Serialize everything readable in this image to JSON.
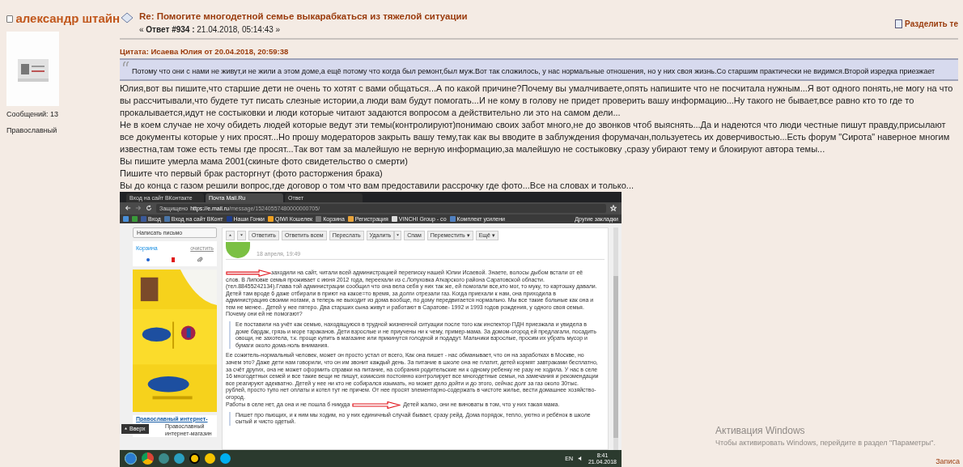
{
  "post": {
    "checked": false,
    "author": "александр штайн",
    "posts_count": "Сообщений: 13",
    "rank": "Православный",
    "title": "Re: Помогите многодетной семье выкарабкаться из тяжелой ситуации",
    "reply_prefix": "« ",
    "reply_label": "Ответ #934 :",
    "reply_date": " 21.04.2018, 05:14:43 »",
    "split_link": "Разделить те",
    "quote_header": "Цитата: Исаева Юлия от 20.04.2018, 20:59:38",
    "quote_text": "Потому что они с нами не живут,и не жили а этом доме,а ещё потому что когда был ремонт,был муж.Вот так сложилось, у нас нормальные отношения, но у них своя жизнь.Со старшим практически не видимся.Второй изредка приезжает",
    "body": [
      "Юлия,вот вы пишите,что старшие дети не очень то хотят с вами общаться...А по какой причине?Почему вы умалчиваете,опять напишите что не посчитала нужным...Я вот одного понять,не могу на что вы рассчитывали,что будете тут писать слезные истории,а люди вам будут помогать...И не кому в голову не придет проверить вашу информацию...Ну такого не бывает,все равно кто то где то прокалывается,идут не состыковки и люди которые читают задаются вопросом а действительно ли это на самом дели...",
      "Не в коем случае не хочу обидеть людей которые ведут эти темы(контролируют)понимаю своих забот много,не до звонков чтоб выяснять...Да и надеются что люди честные пишут правду,присылают все документы которые у них просят...Но прошу модераторов закрыть вашу тему,так как вы вводите в заблуждения форумачан,пользуетесь их доверчивостью...Есть форум \"Сирота\" наверное многим известна,там тоже есть темы где просят...Так вот там за малейшую не верную информацию,за малейшую не состыковку ,сразу убирают тему и блокируют автора темы...",
      "Вы пишите умерла мама 2001(скиньте фото свидетельство о смерти)",
      "Пишите что первый брак  расторгнут (фото расторжения брака)",
      "Вы до конца с газом решили вопрос,где договор о том что вам предоставили рассрочку где фото...Все на словах и только..."
    ],
    "footer_link": "Записа"
  },
  "attached_screenshot": {
    "tabs": [
      {
        "label": "Вход на сайт ВКонтакте",
        "selected": false
      },
      {
        "label": "Почта Mail.Ru",
        "selected": true
      },
      {
        "label": "Ответ",
        "selected": false
      }
    ],
    "secure_label": "Защищено",
    "url_host": "https://e.mail.ru",
    "url_path": "/message/15240557480000000705/",
    "bookmarks": [
      "Вход",
      "Вход на сайт ВКонт",
      "Наши Гонки",
      "QIWI Кошелек",
      "Корзина",
      "Регистрация",
      "VINCHI Group - со",
      "Комплект усилени"
    ],
    "other_bookmarks": "Другие закладки",
    "compose_button": "Написать письмо",
    "trash_folder": "Корзина",
    "clear_link": "очистить",
    "toolbar": [
      {
        "label": "Ответить",
        "dropdown": false
      },
      {
        "label": "Ответить всем",
        "dropdown": false
      },
      {
        "label": "Переслать",
        "dropdown": false
      },
      {
        "label": "Удалить",
        "dropdown": true
      },
      {
        "label": "Спам",
        "dropdown": false
      },
      {
        "label": "Переместить ▾",
        "dropdown": false
      },
      {
        "label": "Ещё ▾",
        "dropdown": false
      }
    ],
    "message_date": "18 апреля, 19:49",
    "message": [
      {
        "kind": "arrow_paragraph",
        "lead": "заходили на сайт, читали всей администрацией  переписку нашей Юлии Исаевой. Знаете, волосы дыбом встали от её",
        "text": "слов. В Липовке семья проживает с июня 2012 года, переехали из с.Лопуховка Аткарского района Саратовской области. (тел.88455242134).Глава той администрации сообщил что она вела себя у них так же, ей помогали все,кто мог, то муку, то картошку давали. Детей там вроде 6 даже  отбирали в приют на какое=то время, за долги отрезали газ. Когда приехали к нам, она приходила в администрацию своими ногами, а теперь не выходит из дома вообще, по дому передвигается нормально. Мы все такие больные как она и тем не менее.. Детей у нее пятеро. Два старших сына живут и работают в Саратове- 1992 и 1993 годов рождения, у одного своя семья. Почему они ей не помогают?"
      },
      {
        "kind": "quote",
        "text": "Ее поставили на учёт как семью, находящуюся в трудной жизненной ситуации после того как инспектор ПДН приезжала и увидела  в доме бардак, грязь и море тараканов. Дети взрослые и не приучены ни к чему, пример-мама. За домом-огород ей предлагали, посадить овощи, не захотела, т.к. проще купить в магазине или прикинутся голодной и подадут. Мальчики взрослые, просим их убрать мусор и бумаги около дома-ноль внимания."
      },
      {
        "kind": "split_paragraph",
        "text": "Ее сожитель-нормальный человек, может он просто  устал от всего,  Как она пишет - нас обманывает, что он на заработках в Москве, но зачем это? Даже дети нам говорили, что он им звонит каждый день. За питание в школе она не платит, детей кормят завтраками бесплатно, за счёт других, она не может оформить справки на питание, на собрания родительские ни к одному ребенку не разу не ходила. У нас в селе 16 многодетных семей и все такие вещи не пишут, комиссия постоянно контролирует все многодетные семьи, на замечания и рекомендации все реагируют адекватно. Детей у нее ни кто не собирался изымать, но может дело дойти и до этого, сейчас долг за газ около 30тыс. рублей, просто тупо нет оплаты и котел тут не причем. От нее просят элементарно-содержать в чистоте жилье, вести домашнее хозяйство- огород.",
        "before_arrow": "Работы в селе нет, да она и не пошла б никуда",
        "after": "Детей жалко, они не виноваты в том, что у них такая мама."
      },
      {
        "kind": "quote",
        "text": "Пишет про пьющих, и к ним мы ходим, но у них единичный случай бывает, сразу рейд. Дома порядок, тепло, уютно и ребёнок в школе сытый и чисто одетый."
      }
    ],
    "ad_link": "Православный интернет-",
    "ad_text": "Православный интернет-магазин",
    "up_button": "Вверх",
    "language": "EN",
    "time": "8:41",
    "date": "21.04.2018"
  },
  "activation": {
    "title": "Активация Windows",
    "text": "Чтобы активировать Windows, перейдите в раздел \"Параметры\"."
  }
}
